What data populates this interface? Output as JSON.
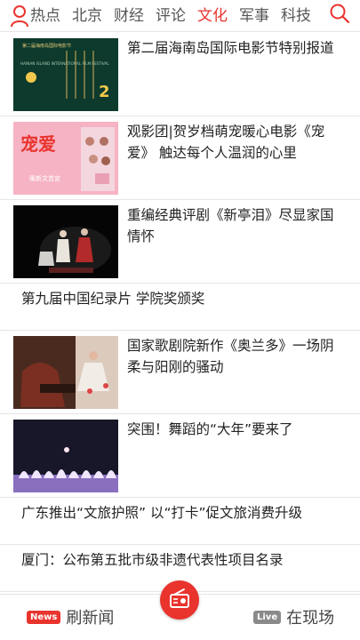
{
  "nav": {
    "tabs": [
      {
        "label": "热点",
        "active": false
      },
      {
        "label": "北京",
        "active": false
      },
      {
        "label": "财经",
        "active": false
      },
      {
        "label": "评论",
        "active": false
      },
      {
        "label": "文化",
        "active": true
      },
      {
        "label": "军事",
        "active": false
      },
      {
        "label": "科技",
        "active": false
      }
    ],
    "accent_color": "#e9332d",
    "icons": {
      "user": "user-icon",
      "search": "search-icon"
    }
  },
  "feed": {
    "items": [
      {
        "title": "第二届海南岛国际电影节特别报道",
        "thumb_text": [
          "第二届海南岛国际电影节",
          "HAINAN ISLAND INTERNATIONAL FILM FESTIVAL",
          "2"
        ]
      },
      {
        "title": "观影团|贺岁档萌宠暖心电影《宠爱》 触达每个人温润的心里",
        "thumb_text": [
          "宠爱",
          "暖新文首宣"
        ]
      },
      {
        "title": "重编经典评剧《新亭泪》尽显家国情怀"
      },
      {
        "title": "第九届中国纪录片 学院奖颁奖"
      },
      {
        "title": "国家歌剧院新作《奥兰多》一场阴柔与阳刚的骚动"
      },
      {
        "title": "突围！舞蹈的“大年”要来了"
      },
      {
        "title": "广东推出“文旅护照” 以“打卡”促文旅消费升级"
      },
      {
        "title": "厦门：公布第五批市级非遗代表性项目名录"
      }
    ]
  },
  "bottom": {
    "refresh": {
      "badge": "News",
      "label": "刷新闻"
    },
    "live": {
      "badge": "Live",
      "label": "在现场"
    },
    "center_icon": "radio-icon"
  }
}
